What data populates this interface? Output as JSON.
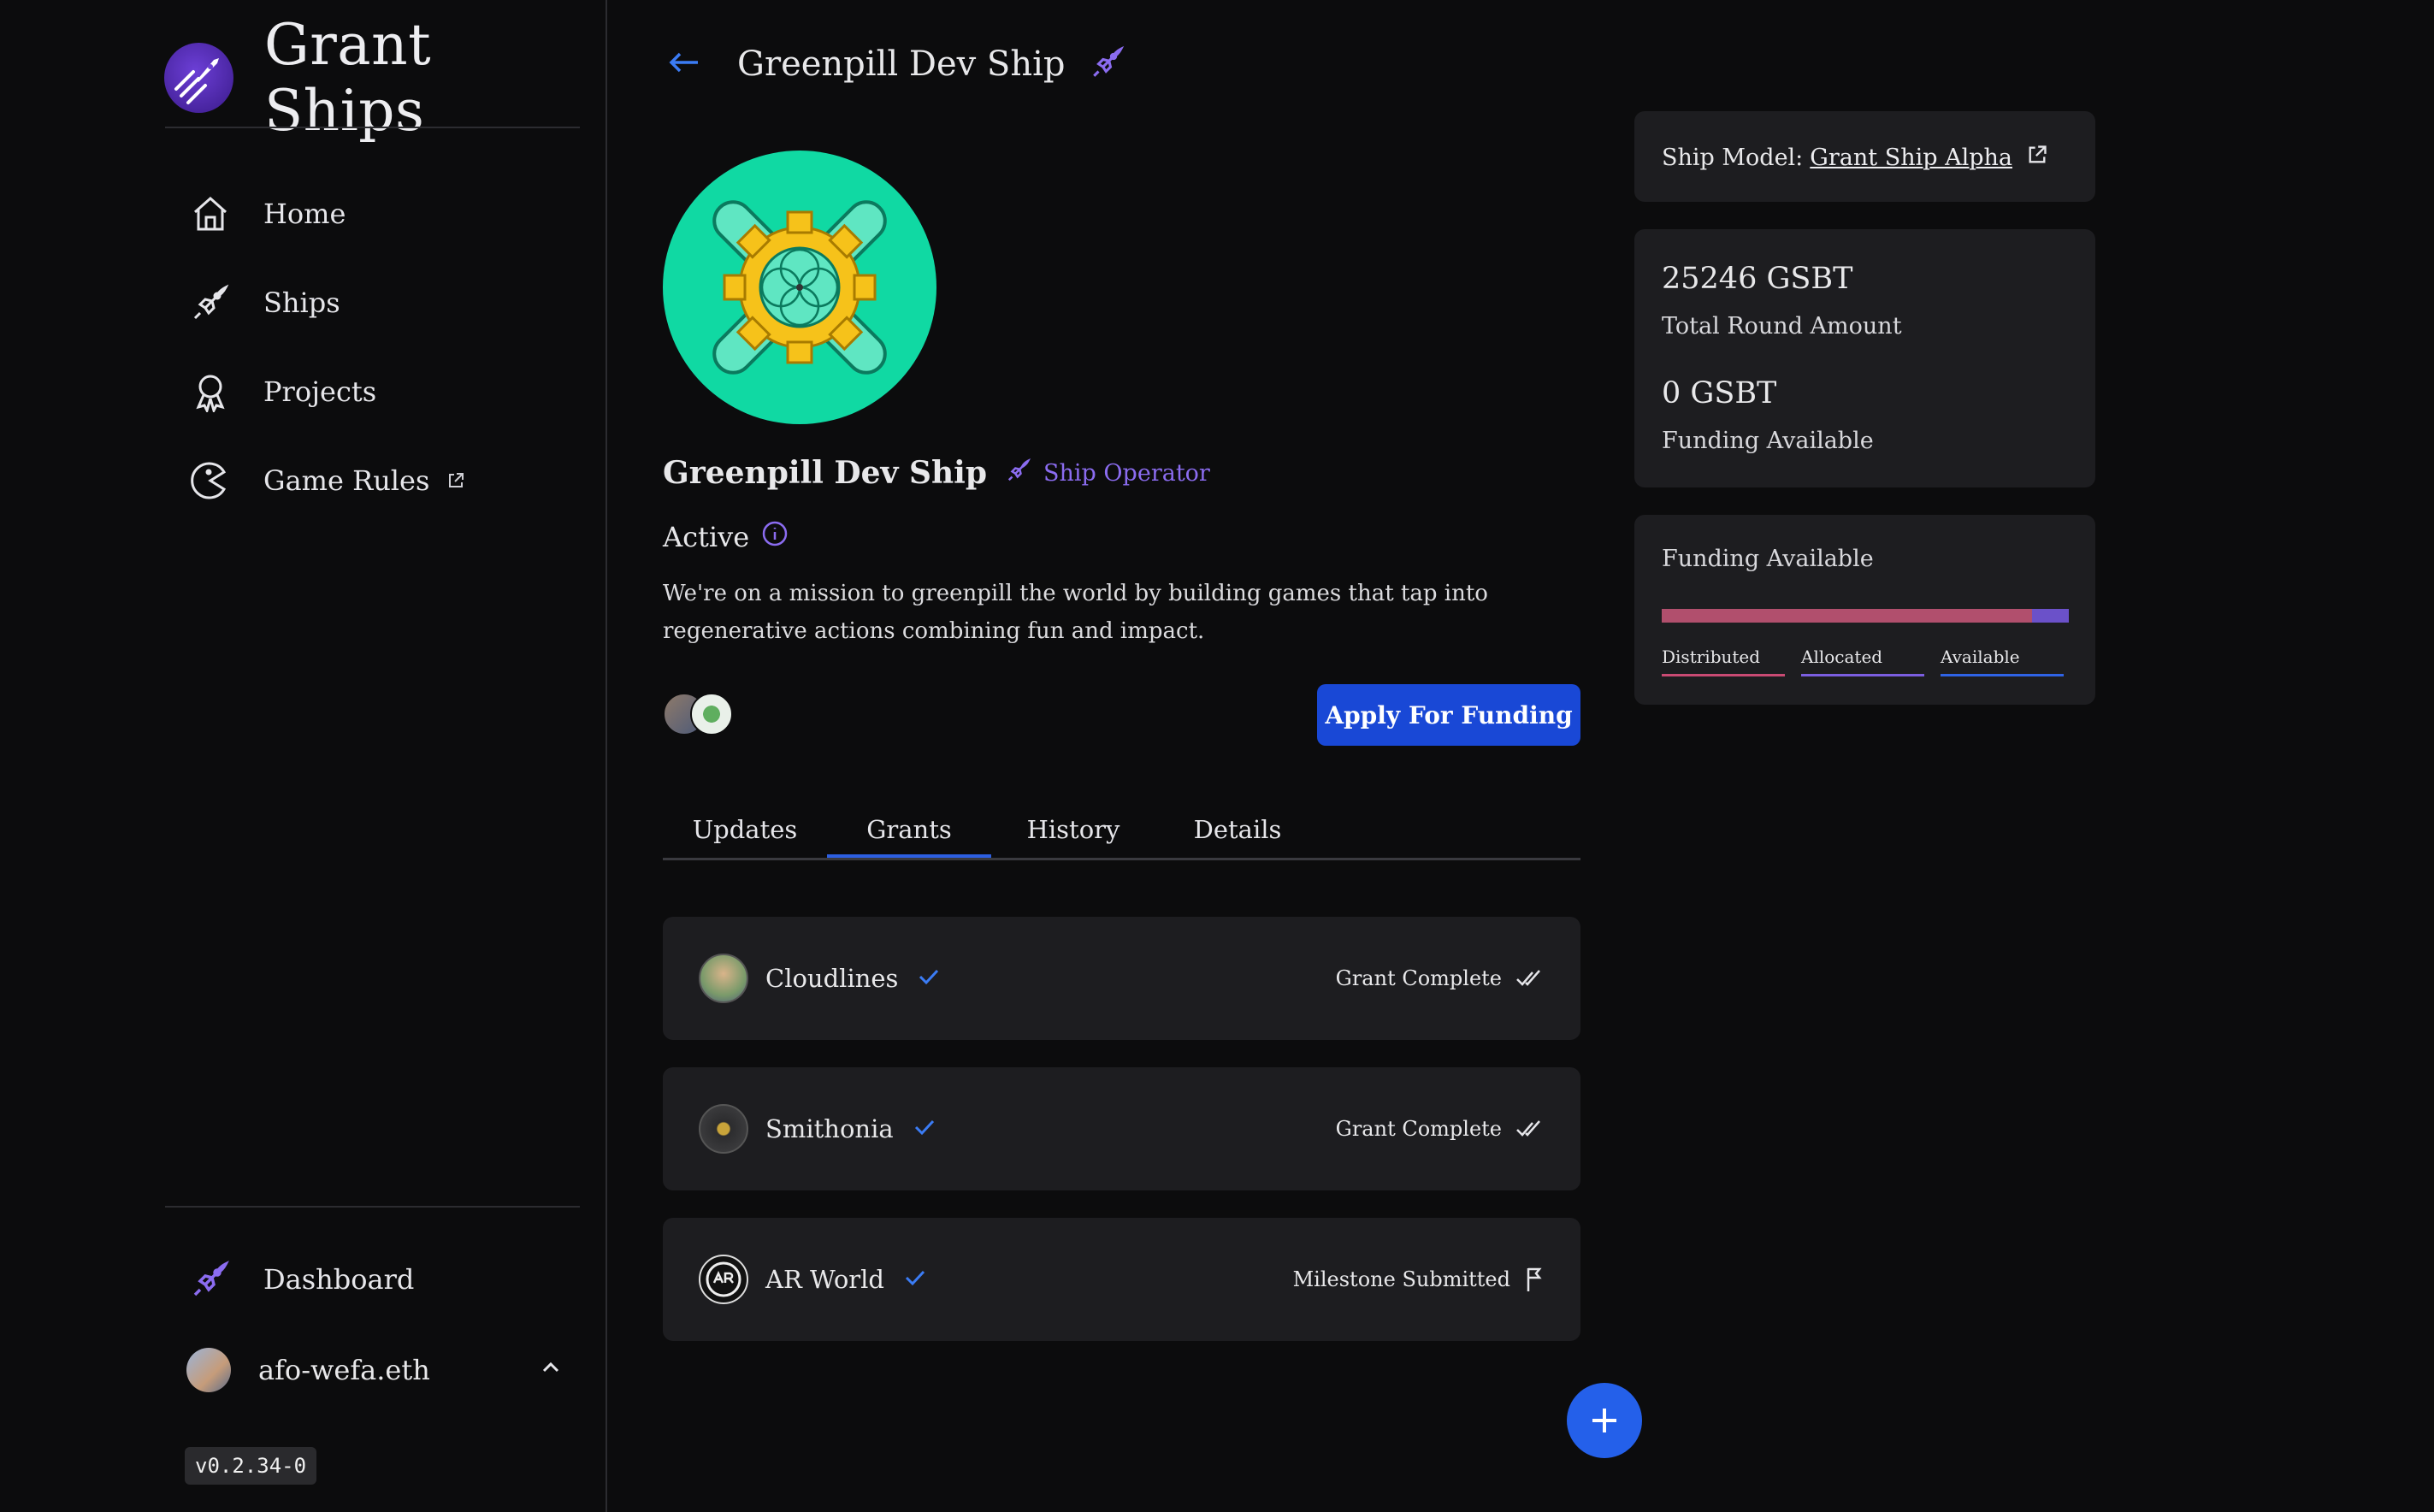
{
  "sidebar": {
    "app_title": "Grant Ships",
    "nav": [
      {
        "label": "Home",
        "icon": "home-icon"
      },
      {
        "label": "Ships",
        "icon": "rocket-icon"
      },
      {
        "label": "Projects",
        "icon": "award-icon"
      },
      {
        "label": "Game Rules",
        "icon": "game-icon"
      }
    ],
    "dashboard_label": "Dashboard",
    "user_name": "afo-wefa.eth",
    "version": "v0.2.34-0"
  },
  "header": {
    "title": "Greenpill Dev Ship"
  },
  "ship": {
    "name": "Greenpill Dev Ship",
    "operator_label": "Ship Operator",
    "status": "Active",
    "description": "We're on a mission to greenpill the world by building games that tap into regenerative actions combining fun and impact.",
    "apply_label": "Apply For Funding"
  },
  "tabs": [
    "Updates",
    "Grants",
    "History",
    "Details"
  ],
  "active_tab": "Grants",
  "grants": [
    {
      "name": "Cloudlines",
      "status": "Grant Complete",
      "status_icon": "double-check-icon"
    },
    {
      "name": "Smithonia",
      "status": "Grant Complete",
      "status_icon": "double-check-icon"
    },
    {
      "name": "AR World",
      "status": "Milestone Submitted",
      "status_icon": "flag-icon"
    }
  ],
  "side": {
    "ship_model_label": "Ship Model:",
    "ship_model_value": "Grant Ship Alpha",
    "total_amount": "25246 GSBT",
    "total_label": "Total Round Amount",
    "available_amount": "0 GSBT",
    "available_label": "Funding Available",
    "funding_title": "Funding Available",
    "legend": [
      {
        "label": "Distributed",
        "color": "#c94a73"
      },
      {
        "label": "Allocated",
        "color": "#7b5ee0"
      },
      {
        "label": "Available",
        "color": "#2f63e6"
      }
    ],
    "distributed_fraction": 0.91
  },
  "colors": {
    "accent": "#8b6cf0",
    "primary_button": "#1948d6",
    "fab": "#2460ea",
    "logo_bg": "#10d9a3"
  }
}
